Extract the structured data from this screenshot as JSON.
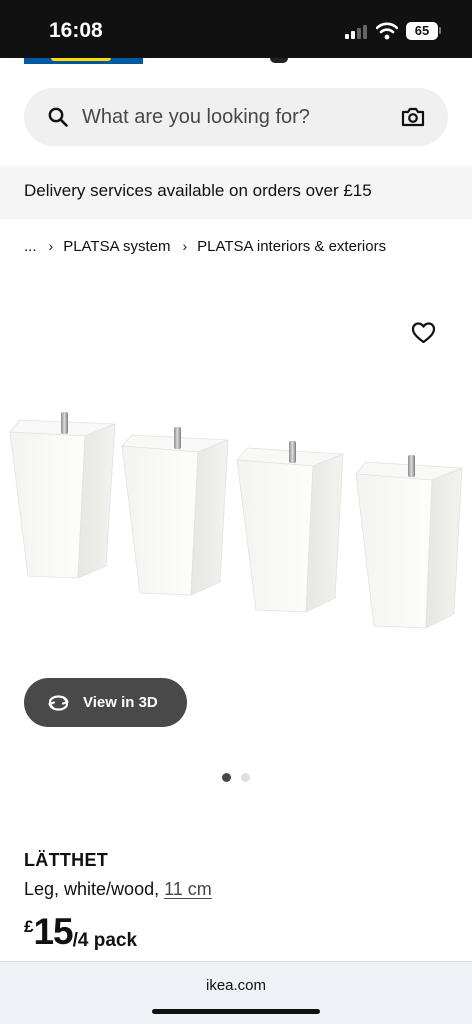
{
  "status_bar": {
    "time": "16:08",
    "battery": "65"
  },
  "search": {
    "placeholder": "What are you looking for?"
  },
  "delivery_banner": {
    "text": "Delivery services available on orders over £15"
  },
  "breadcrumb": {
    "items": [
      "...",
      "PLATSA system",
      "PLATSA interiors & exteriors"
    ],
    "separator": "›"
  },
  "view_3d": {
    "label": "View in 3D"
  },
  "carousel": {
    "total": 2,
    "active": 1
  },
  "product": {
    "name": "LÄTTHET",
    "description": "Leg, white/wood,",
    "size": "11 cm",
    "price_currency": "£",
    "price_value": "15",
    "price_unit": "/4 pack"
  },
  "browser": {
    "url": "ikea.com"
  },
  "colors": {
    "ikea_blue": "#0058a3",
    "ikea_yellow": "#ffdb00",
    "button_dark": "#494949"
  },
  "icons": [
    "search-icon",
    "camera-icon",
    "heart-icon",
    "rotate-3d-icon",
    "wifi-icon",
    "signal-icon"
  ]
}
